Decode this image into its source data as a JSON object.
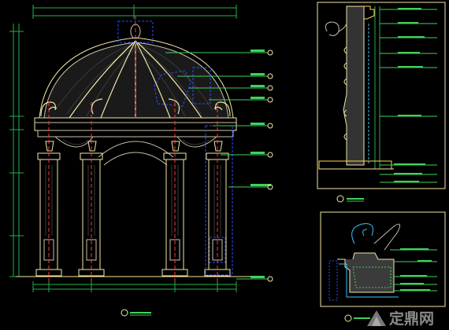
{
  "drawing": {
    "background": "#000000",
    "colors": {
      "outline": "#f2e6a6",
      "grid": "#1fb24a",
      "dim": "#3cc3ff",
      "label": "#3fd25b",
      "accent": "#c7bfa8",
      "annotation": "#2a4fff",
      "axis": "#ff3a3a",
      "highlight": "#ffd84a",
      "fill_pattern": "#2b2b2b",
      "section_fill": "#3b3b3b"
    },
    "elevation": {
      "title": "",
      "scale_tag": "",
      "callout_labels": [
        "",
        "",
        "",
        "",
        "",
        "",
        "",
        ""
      ]
    },
    "section": {
      "title": "",
      "labels": [
        "",
        "",
        "",
        "",
        "",
        "",
        "",
        "",
        ""
      ]
    },
    "detail": {
      "title": "",
      "labels": [
        "",
        "",
        "",
        "",
        ""
      ]
    },
    "watermark": {
      "text": "定鼎网",
      "logo_icon": "ding-logo-icon"
    }
  }
}
